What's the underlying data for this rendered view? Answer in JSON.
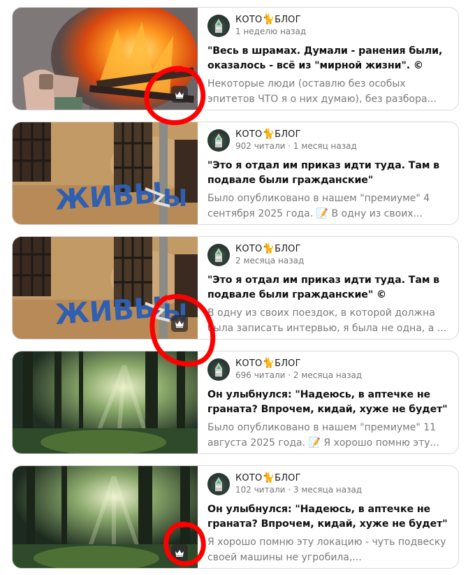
{
  "feed": {
    "cards": [
      {
        "channel": "КОТО",
        "channel_suffix": "БЛОГ",
        "cat_emoji": "🐈",
        "meta": "1 неделю назад",
        "title": "\"Весь в шрамах. Думали - ранения были, оказалось - всё из \"мирной жизни\". ©",
        "desc": "Некоторые люди (оставлю без особых эпитетов ЧТО я о них думаю), без разбора...",
        "premium_icon": "crown-icon",
        "thumb": "fire-hands"
      },
      {
        "channel": "КОТО",
        "channel_suffix": "БЛОГ",
        "cat_emoji": "🐈",
        "meta": "902 читали · 1 месяц назад",
        "title": "\"Это я отдал им приказ идти туда. Там в подвале были гражданские\"",
        "desc_before": "Было опубликовано в нашем \"премиуме\" 4 сентября 2025 года.",
        "desc_emoji": "📝",
        "desc_after": "В одну из своих...",
        "thumb": "wall-graffiti"
      },
      {
        "channel": "КОТО",
        "channel_suffix": "БЛОГ",
        "cat_emoji": "🐈",
        "meta": "2 месяца назад",
        "title": "\"Это я отдал им приказ идти туда. Там в подвале были гражданские\" ©",
        "desc": "В одну из своих поездок, в которой должна была записать интервью, я была не одна, а ...",
        "premium_icon": "crown-icon",
        "thumb": "wall-graffiti"
      },
      {
        "channel": "КОТО",
        "channel_suffix": "БЛОГ",
        "cat_emoji": "🐈",
        "meta": "696 читали · 2 месяца назад",
        "title": "Он улыбнулся: \"Надеюсь, в аптечке не граната? Впрочем, кидай, хуже не будет\"",
        "desc_before": "Было опубликовано в нашем \"премиуме\" 11 августа 2025 года.",
        "desc_emoji": "📝",
        "desc_after": "Я хорошо помню эту...",
        "thumb": "forest"
      },
      {
        "channel": "КОТО",
        "channel_suffix": "БЛОГ",
        "cat_emoji": "🐈",
        "meta": "102 читали · 3 месяца назад",
        "title": "Он улыбнулся: \"Надеюсь, в аптечке не граната? Впрочем, кидай, хуже не будет\"",
        "desc": "Я хорошо помню эту локацию - чуть подвеску своей машины не угробила,...",
        "premium_icon": "crown-icon",
        "thumb": "forest"
      }
    ],
    "graffiti_text": "ЖИВЫ",
    "graffiti_text2": "Ы",
    "annotation_color": "#ff0000",
    "premium_badge_color": "#2b2b2b"
  }
}
